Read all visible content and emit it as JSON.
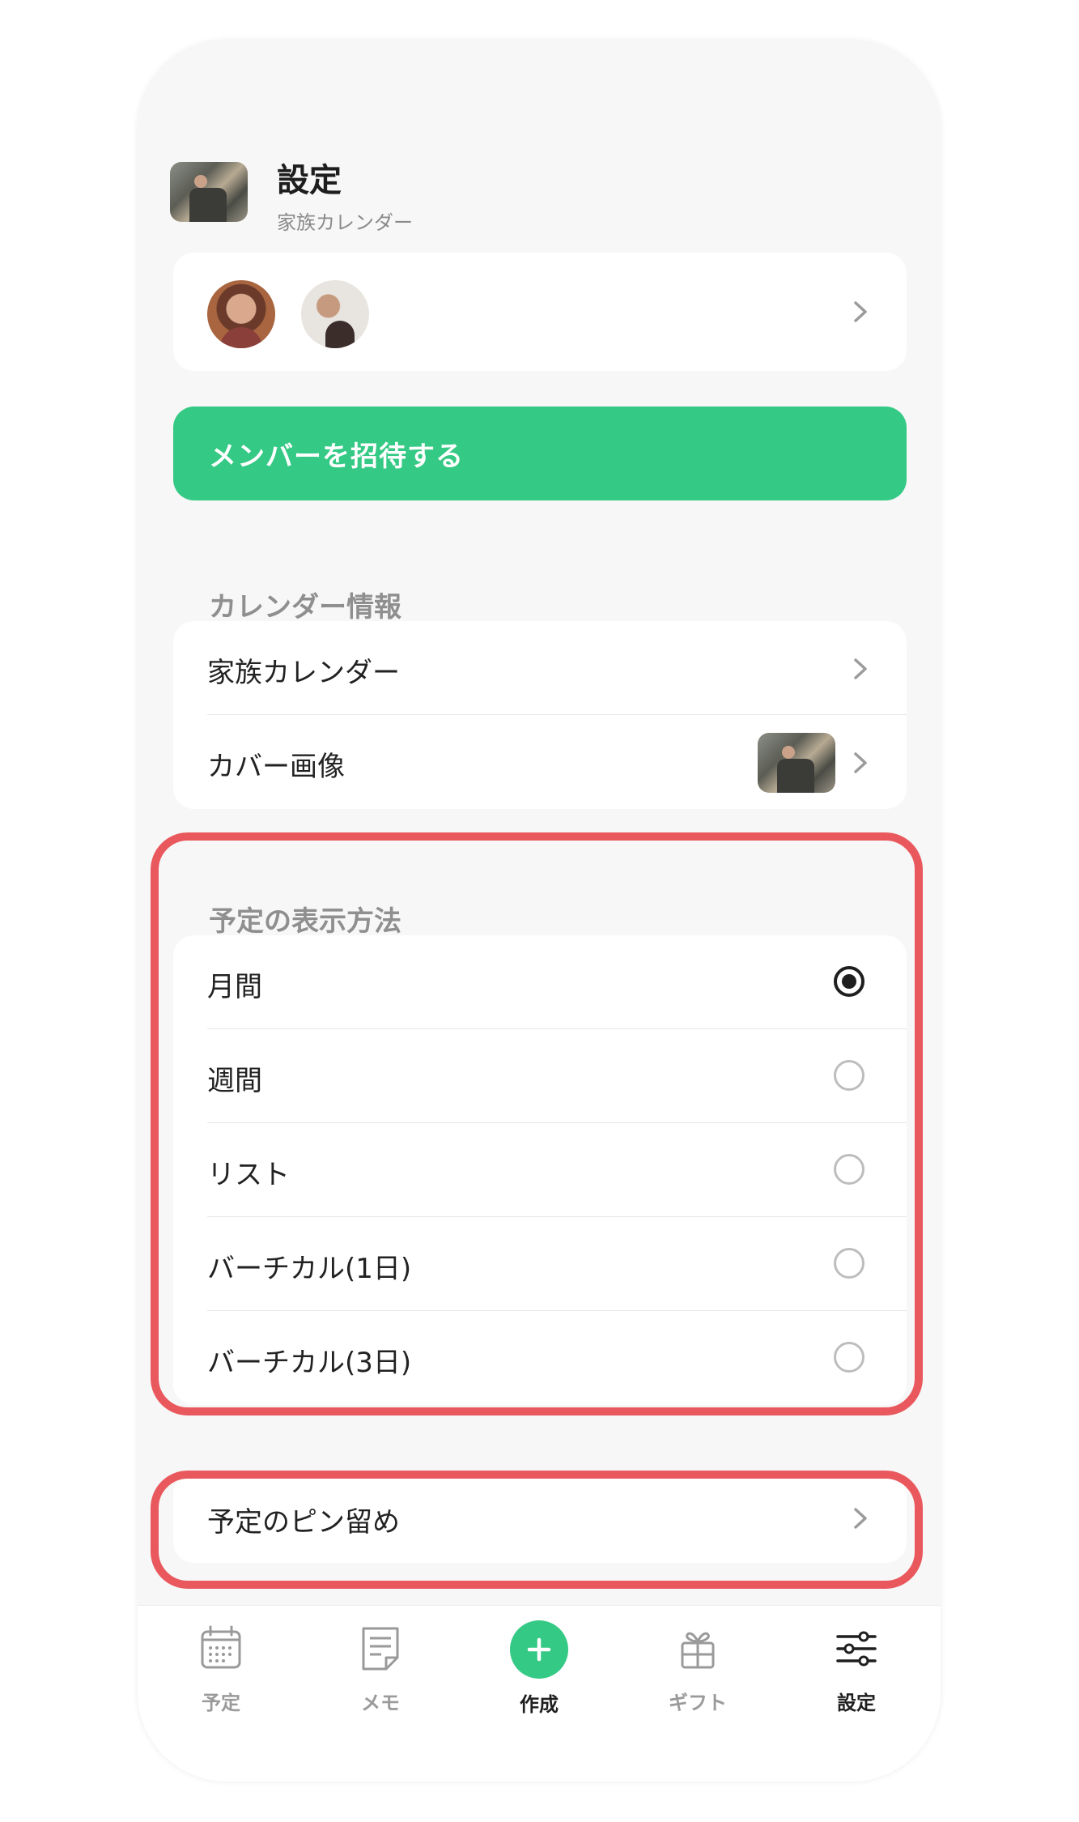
{
  "header": {
    "title": "設定",
    "subtitle": "家族カレンダー",
    "thumbnail_icon": "calendar-cover-photo"
  },
  "members": {
    "avatars": [
      "member-avatar-1",
      "member-avatar-2"
    ]
  },
  "invite_button": {
    "label": "メンバーを招待する",
    "color": "#34c984"
  },
  "calendar_info": {
    "title": "カレンダー情報",
    "rows": [
      {
        "label": "家族カレンダー"
      },
      {
        "label": "カバー画像"
      }
    ]
  },
  "display_method": {
    "title": "予定の表示方法",
    "options": [
      {
        "label": "月間",
        "selected": true
      },
      {
        "label": "週間",
        "selected": false
      },
      {
        "label": "リスト",
        "selected": false
      },
      {
        "label": "バーチカル(1日)",
        "selected": false
      },
      {
        "label": "バーチカル(3日)",
        "selected": false
      }
    ]
  },
  "pin": {
    "label": "予定のピン留め"
  },
  "highlight_color": "#e9585d",
  "tabbar": {
    "tabs": [
      {
        "label": "予定",
        "icon": "calendar-icon",
        "active": false
      },
      {
        "label": "メモ",
        "icon": "memo-icon",
        "active": false
      },
      {
        "label": "作成",
        "icon": "plus-icon",
        "active": false
      },
      {
        "label": "ギフト",
        "icon": "gift-icon",
        "active": false
      },
      {
        "label": "設定",
        "icon": "settings-sliders-icon",
        "active": true
      }
    ]
  }
}
